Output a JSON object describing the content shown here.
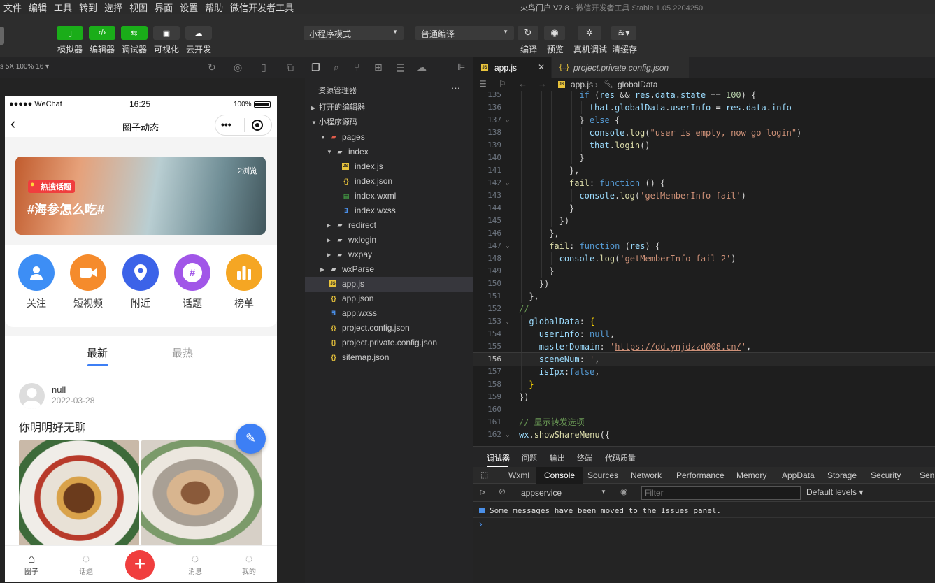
{
  "menubar": {
    "items": [
      "文件",
      "编辑",
      "工具",
      "转到",
      "选择",
      "视图",
      "界面",
      "设置",
      "帮助",
      "微信开发者工具"
    ],
    "title_app": "火鸟门户 V7.8",
    "title_tool": "微信开发者工具 Stable 1.05.2204250"
  },
  "toolbar": {
    "buttons": [
      {
        "label": "模拟器",
        "icon": "phone-icon"
      },
      {
        "label": "编辑器",
        "icon": "code-icon"
      },
      {
        "label": "调试器",
        "icon": "debug-icon"
      },
      {
        "label": "可视化",
        "icon": "layout-icon"
      },
      {
        "label": "云开发",
        "icon": "cloud-icon"
      }
    ],
    "mode_select": "小程序模式",
    "compile_select": "普通编译",
    "actions": [
      "编译",
      "预览",
      "真机调试",
      "清缓存"
    ]
  },
  "simulator": {
    "device": "s 5X 100% 16 ▾"
  },
  "phone": {
    "status": {
      "carrier": "●●●●● WeChat",
      "time": "16:25",
      "battery": "100%"
    },
    "nav_title": "圈子动态",
    "banner": {
      "views": "2浏览",
      "badge": "热搜话题",
      "topic": "#海参怎么吃#"
    },
    "categories": [
      {
        "label": "关注",
        "color": "#3d8ef5"
      },
      {
        "label": "短视频",
        "color": "#f58b2c"
      },
      {
        "label": "附近",
        "color": "#3c63e8"
      },
      {
        "label": "话题",
        "color": "#a156e8"
      },
      {
        "label": "榜单",
        "color": "#f5a623"
      }
    ],
    "feed_tabs": [
      "最新",
      "最热"
    ],
    "post": {
      "user": "null",
      "date": "2022-03-28",
      "text": "你明明好无聊"
    },
    "tabbar": [
      "圈子",
      "话题",
      "消息",
      "我的"
    ]
  },
  "explorer": {
    "title": "资源管理器",
    "more": "···",
    "sections": [
      "打开的编辑器",
      "小程序源码"
    ],
    "tree": [
      {
        "label": "pages",
        "indent": 2,
        "type": "folder-red",
        "open": true
      },
      {
        "label": "index",
        "indent": 3,
        "type": "folder",
        "open": true
      },
      {
        "label": "index.js",
        "indent": 4,
        "type": "js"
      },
      {
        "label": "index.json",
        "indent": 4,
        "type": "json"
      },
      {
        "label": "index.wxml",
        "indent": 4,
        "type": "wxml"
      },
      {
        "label": "index.wxss",
        "indent": 4,
        "type": "wxss"
      },
      {
        "label": "redirect",
        "indent": 3,
        "type": "folder",
        "open": false
      },
      {
        "label": "wxlogin",
        "indent": 3,
        "type": "folder",
        "open": false
      },
      {
        "label": "wxpay",
        "indent": 3,
        "type": "folder",
        "open": false
      },
      {
        "label": "wxParse",
        "indent": 2,
        "type": "folder",
        "open": false
      },
      {
        "label": "app.js",
        "indent": 2,
        "type": "js",
        "selected": true
      },
      {
        "label": "app.json",
        "indent": 2,
        "type": "json"
      },
      {
        "label": "app.wxss",
        "indent": 2,
        "type": "wxss"
      },
      {
        "label": "project.config.json",
        "indent": 2,
        "type": "json"
      },
      {
        "label": "project.private.config.json",
        "indent": 2,
        "type": "json"
      },
      {
        "label": "sitemap.json",
        "indent": 2,
        "type": "json"
      }
    ]
  },
  "editor": {
    "tabs": [
      {
        "label": "app.js",
        "active": true,
        "close": "✕"
      },
      {
        "label": "project.private.config.json",
        "active": false
      }
    ],
    "breadcrumb": [
      "app.js",
      "globalData"
    ],
    "current_line": "156",
    "lines": [
      {
        "no": "135",
        "fold": "",
        "indent": 6,
        "html": "<span class='k'>if</span> (<span class='p'>res</span> && <span class='p'>res</span>.<span class='p'>data</span>.<span class='p'>state</span> == <span class='n'>100</span>) {"
      },
      {
        "no": "136",
        "fold": "",
        "indent": 7,
        "html": "<span class='p'>that</span>.<span class='p'>globalData</span>.<span class='p'>userInfo</span> = <span class='p'>res</span>.<span class='p'>data</span>.<span class='p'>info</span>"
      },
      {
        "no": "137",
        "fold": "⌄",
        "indent": 6,
        "html": "} <span class='k'>else</span> {"
      },
      {
        "no": "138",
        "fold": "",
        "indent": 7,
        "html": "<span class='p'>console</span>.<span class='f'>log</span>(<span class='s'>\"user is empty, now go login\"</span>)"
      },
      {
        "no": "139",
        "fold": "",
        "indent": 7,
        "html": "<span class='p'>that</span>.<span class='f'>login</span>()"
      },
      {
        "no": "140",
        "fold": "",
        "indent": 6,
        "html": "}"
      },
      {
        "no": "141",
        "fold": "",
        "indent": 5,
        "html": "},"
      },
      {
        "no": "142",
        "fold": "⌄",
        "indent": 5,
        "html": "<span class='f'>fail</span>: <span class='k'>function</span> () {"
      },
      {
        "no": "143",
        "fold": "",
        "indent": 6,
        "html": "<span class='p'>console</span>.<span class='f'>log</span>(<span class='s'>'getMemberInfo fail'</span>)"
      },
      {
        "no": "144",
        "fold": "",
        "indent": 5,
        "html": "}"
      },
      {
        "no": "145",
        "fold": "",
        "indent": 4,
        "html": "})"
      },
      {
        "no": "146",
        "fold": "",
        "indent": 3,
        "html": "},"
      },
      {
        "no": "147",
        "fold": "⌄",
        "indent": 3,
        "html": "<span class='f'>fail</span>: <span class='k'>function</span> (<span class='p'>res</span>) {"
      },
      {
        "no": "148",
        "fold": "",
        "indent": 4,
        "html": "<span class='p'>console</span>.<span class='f'>log</span>(<span class='s'>'getMemberInfo fail 2'</span>)"
      },
      {
        "no": "149",
        "fold": "",
        "indent": 3,
        "html": "}"
      },
      {
        "no": "150",
        "fold": "",
        "indent": 2,
        "html": "})"
      },
      {
        "no": "151",
        "fold": "",
        "indent": 1,
        "html": "},"
      },
      {
        "no": "152",
        "fold": "",
        "indent": 0,
        "html": "<span class='c'>//</span>"
      },
      {
        "no": "153",
        "fold": "⌄",
        "indent": 1,
        "html": "<span class='p'>globalData</span>: <span class='y'>{</span>"
      },
      {
        "no": "154",
        "fold": "",
        "indent": 2,
        "html": "<span class='p'>userInfo</span>: <span class='k'>null</span>,"
      },
      {
        "no": "155",
        "fold": "",
        "indent": 2,
        "html": "<span class='p'>masterDomain</span>: <span class='s'>'</span><span class='u'>https://dd.ynjdzzd008.cn/</span><span class='s'>'</span>,"
      },
      {
        "no": "156",
        "fold": "",
        "indent": 2,
        "html": "<span class='p'>sceneNum</span>:<span class='s'>''</span>,"
      },
      {
        "no": "157",
        "fold": "",
        "indent": 2,
        "html": "<span class='p'>isIpx</span>:<span class='k'>false</span>,"
      },
      {
        "no": "158",
        "fold": "",
        "indent": 1,
        "html": "<span class='y'>}</span>"
      },
      {
        "no": "159",
        "fold": "",
        "indent": 0,
        "html": "})"
      },
      {
        "no": "160",
        "fold": "",
        "indent": 0,
        "html": ""
      },
      {
        "no": "161",
        "fold": "",
        "indent": 0,
        "html": "<span class='c'>// 显示转发选项</span>"
      },
      {
        "no": "162",
        "fold": "⌄",
        "indent": 0,
        "html": "<span class='p'>wx</span>.<span class='f'>showShareMenu</span>({"
      }
    ]
  },
  "devtools": {
    "top_tabs": [
      "调试器",
      "问题",
      "输出",
      "终端",
      "代码质量"
    ],
    "panels": [
      "Wxml",
      "Console",
      "Sources",
      "Network",
      "Performance",
      "Memory",
      "AppData",
      "Storage",
      "Security",
      "Sens"
    ],
    "context": "appservice",
    "filter_placeholder": "Filter",
    "levels": "Default levels ▾",
    "message": "Some messages have been moved to the Issues panel.",
    "prompt": "›"
  }
}
